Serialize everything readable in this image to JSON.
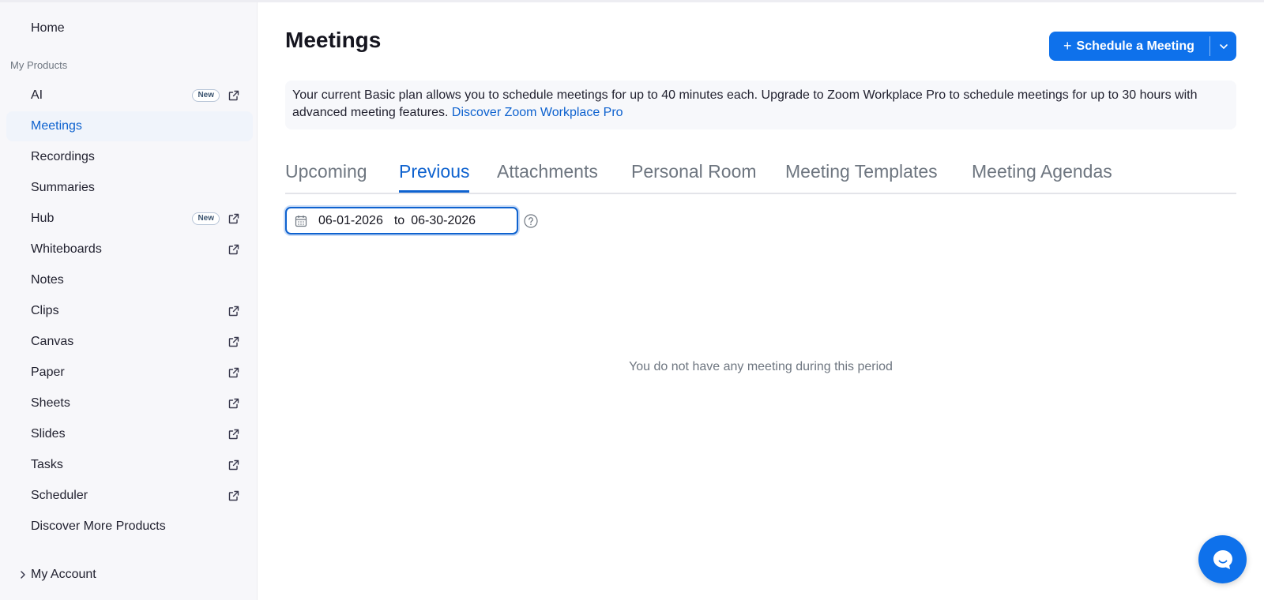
{
  "sidebar": {
    "home": "Home",
    "section_label": "My Products",
    "items": [
      {
        "label": "AI",
        "badge": "New",
        "external": true
      },
      {
        "label": "Meetings",
        "active": true
      },
      {
        "label": "Recordings"
      },
      {
        "label": "Summaries"
      },
      {
        "label": "Hub",
        "badge": "New",
        "external": true
      },
      {
        "label": "Whiteboards",
        "external": true
      },
      {
        "label": "Notes"
      },
      {
        "label": "Clips",
        "external": true
      },
      {
        "label": "Canvas",
        "external": true
      },
      {
        "label": "Paper",
        "external": true
      },
      {
        "label": "Sheets",
        "external": true
      },
      {
        "label": "Slides",
        "external": true
      },
      {
        "label": "Tasks",
        "external": true
      },
      {
        "label": "Scheduler",
        "external": true
      },
      {
        "label": "Discover More Products"
      }
    ],
    "my_account": "My Account"
  },
  "main": {
    "title": "Meetings",
    "schedule_button": {
      "plus": "+",
      "label": "Schedule a Meeting"
    },
    "banner": {
      "text": "Your current Basic plan allows you to schedule meetings for up to 40 minutes each. Upgrade to Zoom Workplace Pro to schedule meetings for up to 30 hours with advanced meeting features.",
      "link": "Discover Zoom Workplace Pro"
    },
    "tabs": [
      {
        "label": "Upcoming"
      },
      {
        "label": "Previous",
        "active": true
      },
      {
        "label": "Attachments"
      },
      {
        "label": "Personal Room"
      },
      {
        "label": "Meeting Templates"
      },
      {
        "label": "Meeting Agendas"
      }
    ],
    "date_range": {
      "from": "06-01-2026",
      "to_word": "to",
      "to": "06-30-2026"
    },
    "empty_message": "You do not have any meeting during this period"
  },
  "colors": {
    "accent": "#0e71eb",
    "link": "#0e62cf",
    "sidebar_bg": "#f7f7fa"
  },
  "icons": {
    "external": "external-link-icon",
    "calendar": "calendar-icon",
    "help": "help-circle-icon",
    "chat": "chat-bubble-icon",
    "chevron_right": "chevron-right-icon",
    "chevron_down": "chevron-down-icon"
  }
}
